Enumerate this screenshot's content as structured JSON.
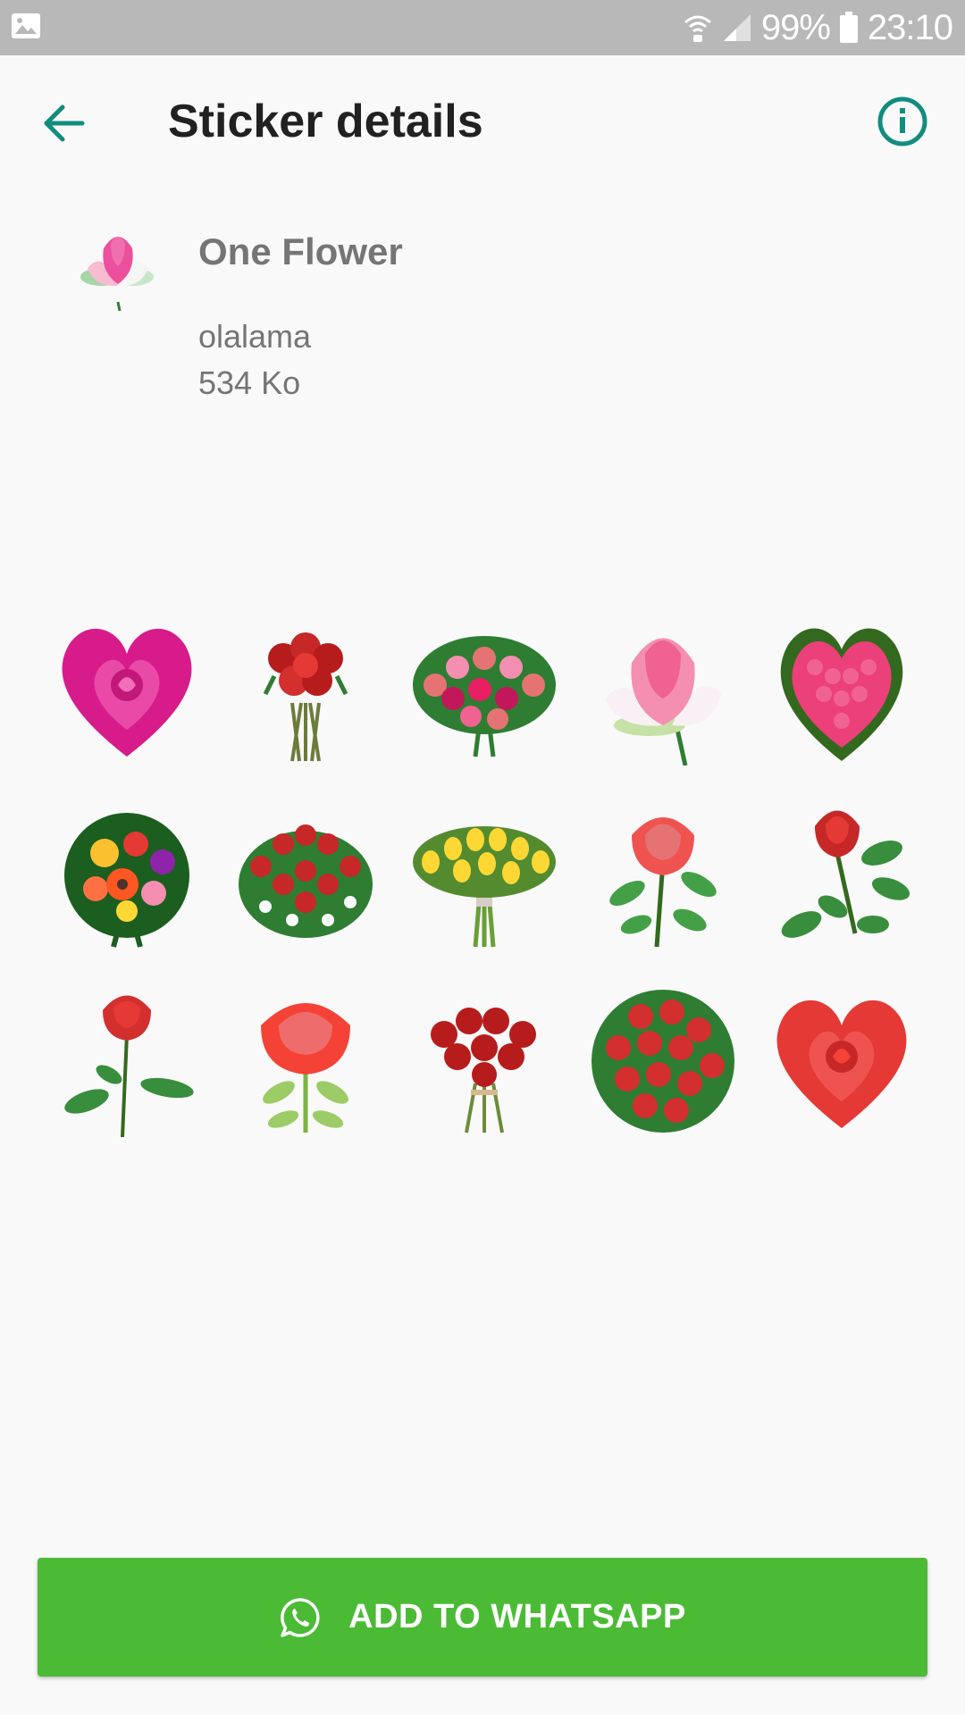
{
  "status_bar": {
    "battery": "99%",
    "time": "23:10",
    "icons": [
      "image-icon",
      "wifi-calling-icon",
      "signal-icon",
      "battery-icon"
    ]
  },
  "app_bar": {
    "title": "Sticker details",
    "back_icon": "arrow-back-icon",
    "info_icon": "info-icon",
    "accent": "#128c7e"
  },
  "pack": {
    "name": "One Flower",
    "author": "olalama",
    "size": "534 Ko",
    "thumbnail": "pink-lotus-icon"
  },
  "stickers": [
    {
      "icon": "pink-heart-rose-sticker"
    },
    {
      "icon": "red-rose-bouquet-sticker"
    },
    {
      "icon": "pink-red-rose-bouquet-sticker"
    },
    {
      "icon": "pink-lotus-sticker"
    },
    {
      "icon": "pink-heart-wreath-sticker"
    },
    {
      "icon": "mixed-gerbera-bouquet-sticker"
    },
    {
      "icon": "red-rose-white-bouquet-sticker"
    },
    {
      "icon": "yellow-tulip-bouquet-sticker"
    },
    {
      "icon": "coral-rose-stem-sticker"
    },
    {
      "icon": "red-rose-leaves-sticker"
    },
    {
      "icon": "red-rose-stem-sticker"
    },
    {
      "icon": "coral-rose-sticker"
    },
    {
      "icon": "red-rose-tied-bouquet-sticker"
    },
    {
      "icon": "red-rose-round-bouquet-sticker"
    },
    {
      "icon": "red-heart-rose-sticker"
    }
  ],
  "add_button": {
    "label": "ADD TO WHATSAPP",
    "icon": "whatsapp-icon",
    "color": "#4bbb36"
  }
}
